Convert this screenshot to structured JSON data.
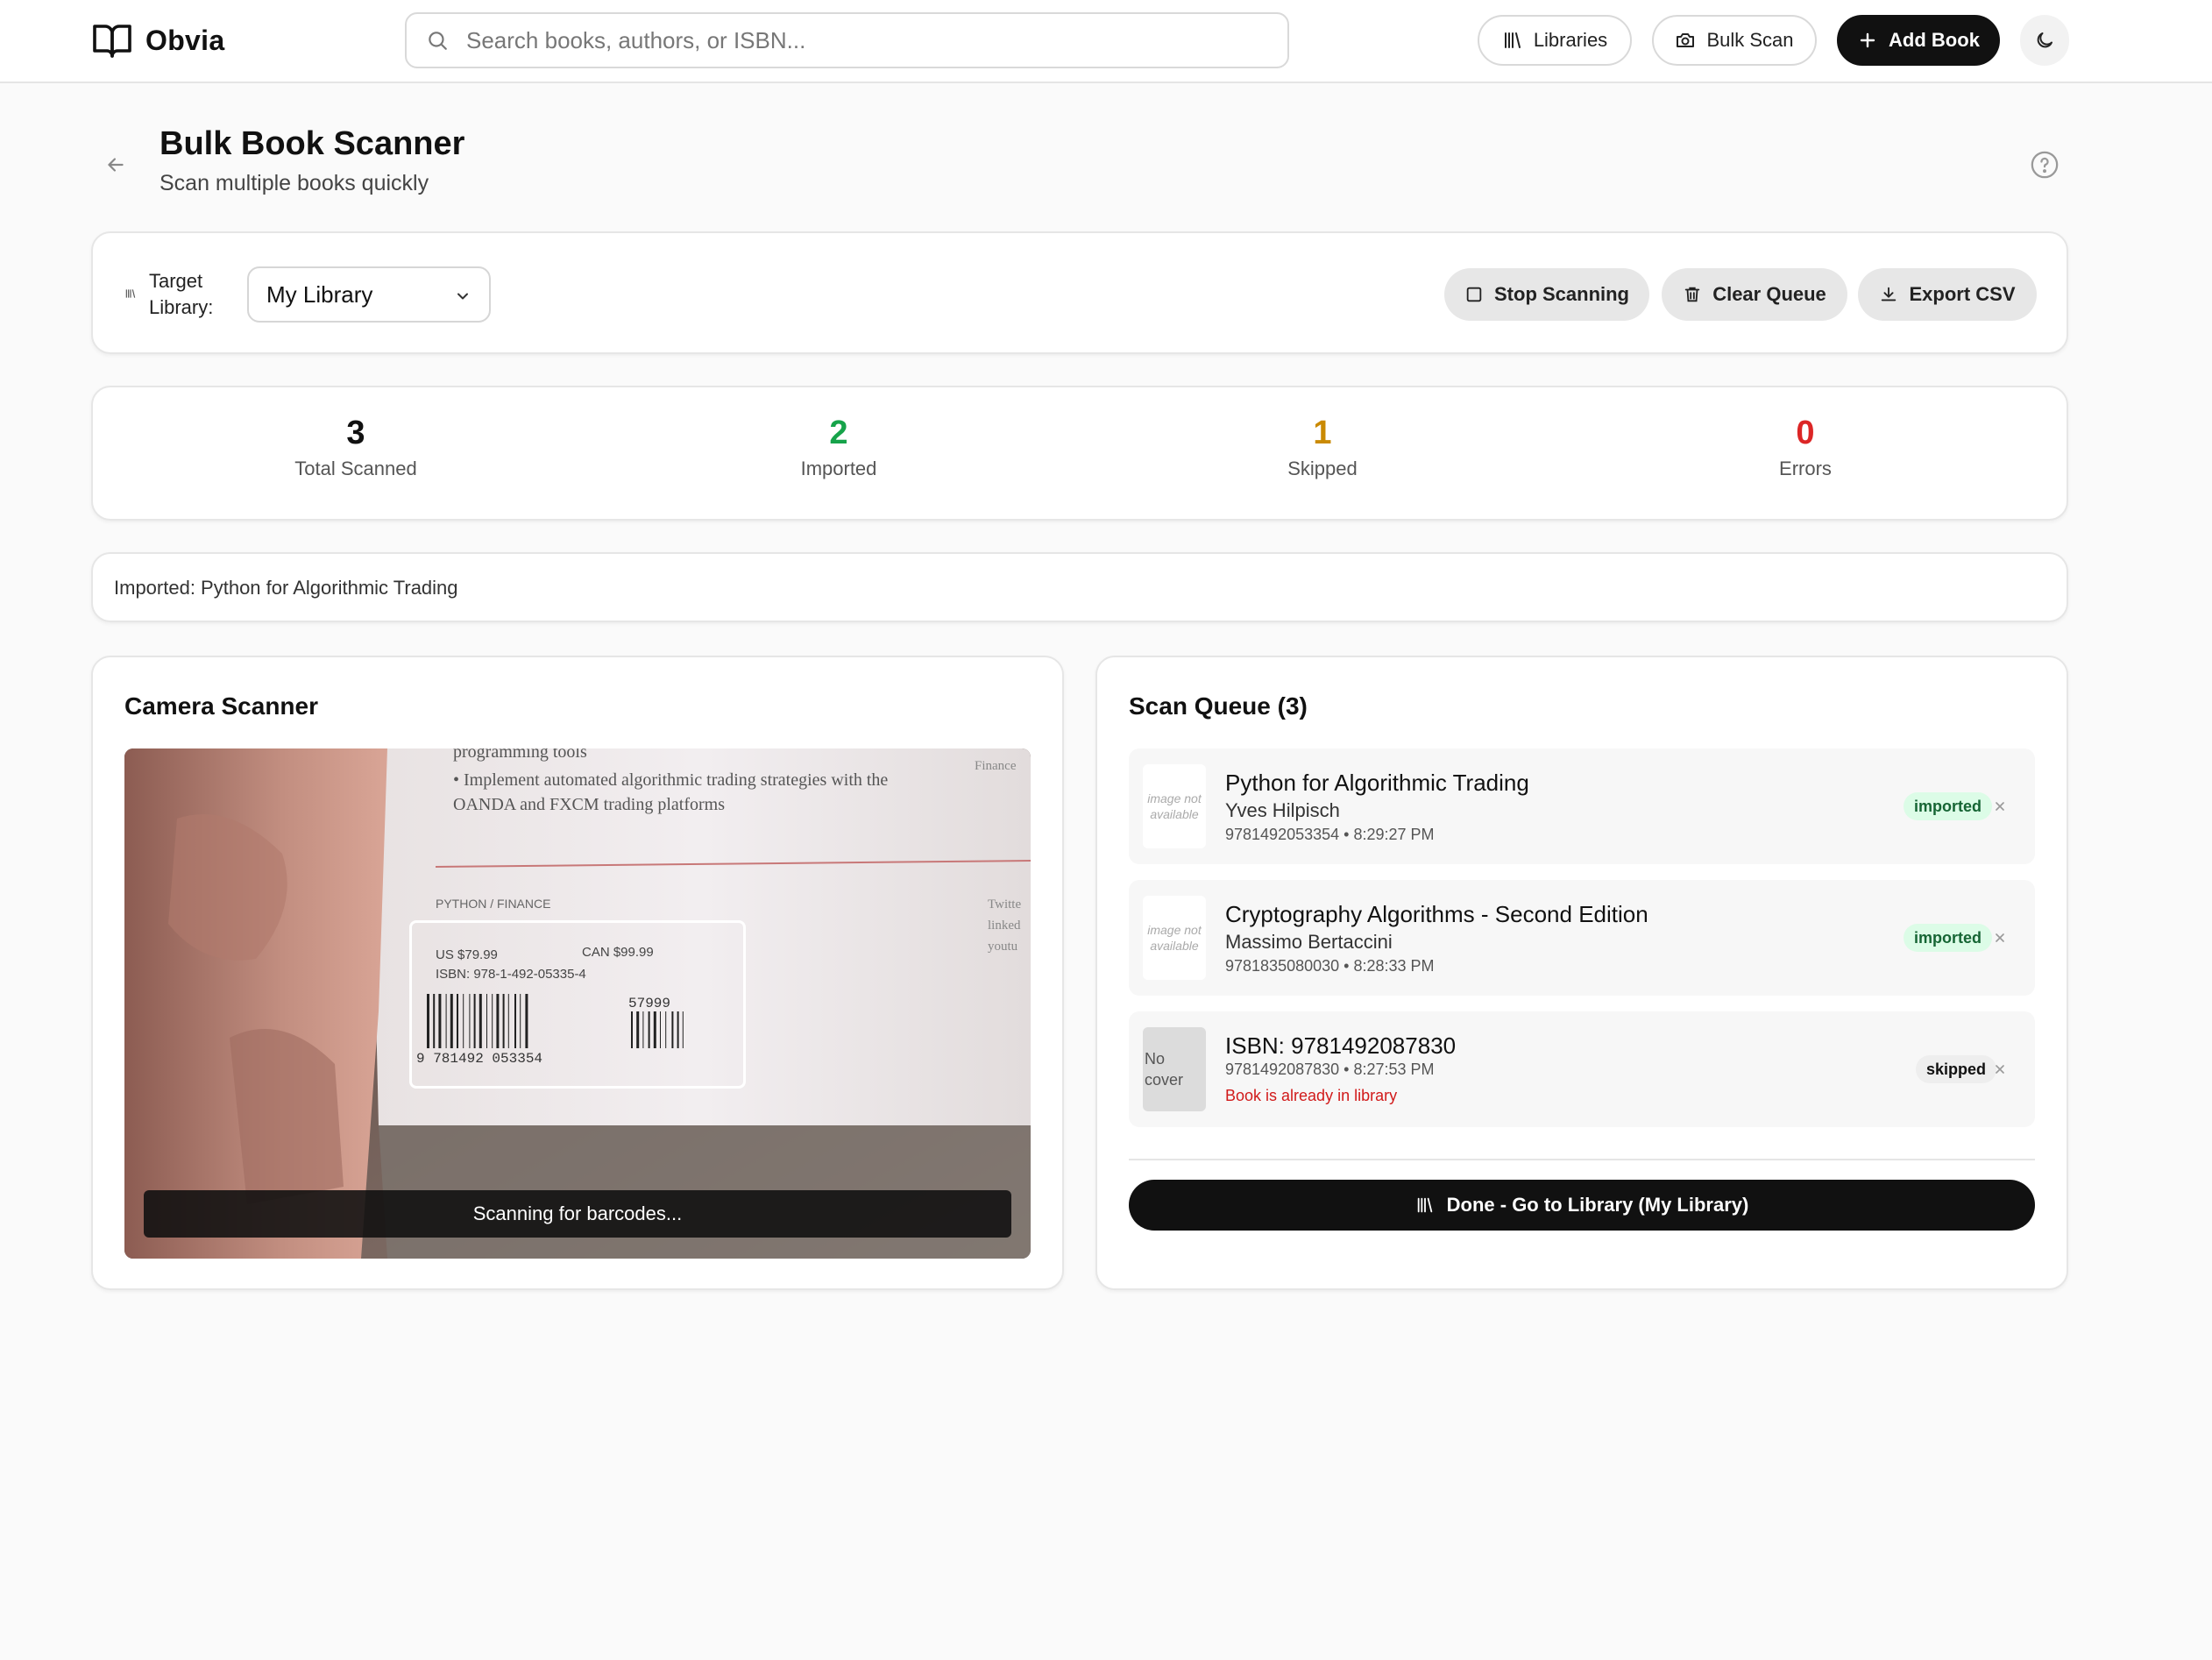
{
  "header": {
    "brand": "Obvia",
    "search_placeholder": "Search books, authors, or ISBN...",
    "libraries_label": "Libraries",
    "bulk_scan_label": "Bulk Scan",
    "add_book_label": "Add Book"
  },
  "page": {
    "title": "Bulk Book Scanner",
    "subtitle": "Scan multiple books quickly"
  },
  "controls": {
    "target_library_label": "Target Library:",
    "selected_library": "My Library",
    "stop_label": "Stop Scanning",
    "clear_label": "Clear Queue",
    "export_label": "Export CSV"
  },
  "stats": [
    {
      "value": "3",
      "label": "Total Scanned",
      "color": "#111111"
    },
    {
      "value": "2",
      "label": "Imported",
      "color": "#16a34a"
    },
    {
      "value": "1",
      "label": "Skipped",
      "color": "#ca8a04"
    },
    {
      "value": "0",
      "label": "Errors",
      "color": "#dc2626"
    }
  ],
  "message": "Imported: Python for Algorithmic Trading",
  "camera": {
    "title": "Camera Scanner",
    "status": "Scanning for barcodes...",
    "scene_text": {
      "line1": "programming tools",
      "line2": "• Implement automated algorithmic trading strategies with the",
      "line3": "OANDA and FXCM trading platforms",
      "category": "PYTHON / FINANCE",
      "price_us": "US $79.99",
      "price_can": "CAN $99.99",
      "isbn": "ISBN: 978-1-492-05335-4",
      "barcode_digits": "9 781492 053354",
      "addon_digits": "57999",
      "side_top": "Finance",
      "side_mid": "Twitte",
      "side_mid2": "linked",
      "side_mid3": "youtu"
    }
  },
  "queue": {
    "title": "Scan Queue (3)",
    "no_image_text": "image not available",
    "no_cover_text": "No cover",
    "items": [
      {
        "title": "Python for Algorithmic Trading",
        "author": "Yves Hilpisch",
        "meta": "9781492053354 • 8:29:27 PM",
        "status": "imported"
      },
      {
        "title": "Cryptography Algorithms - Second Edition",
        "author": "Massimo Bertaccini",
        "meta": "9781835080030 • 8:28:33 PM",
        "status": "imported"
      },
      {
        "title": "ISBN: 9781492087830",
        "meta": "9781492087830 • 8:27:53 PM",
        "status": "skipped",
        "error": "Book is already in library"
      }
    ],
    "done_label": "Done - Go to Library (My Library)"
  },
  "colors": {
    "accent": "#111111",
    "imported_bg": "#dcfce7",
    "imported_text": "#166534",
    "error": "#d11a1a"
  }
}
